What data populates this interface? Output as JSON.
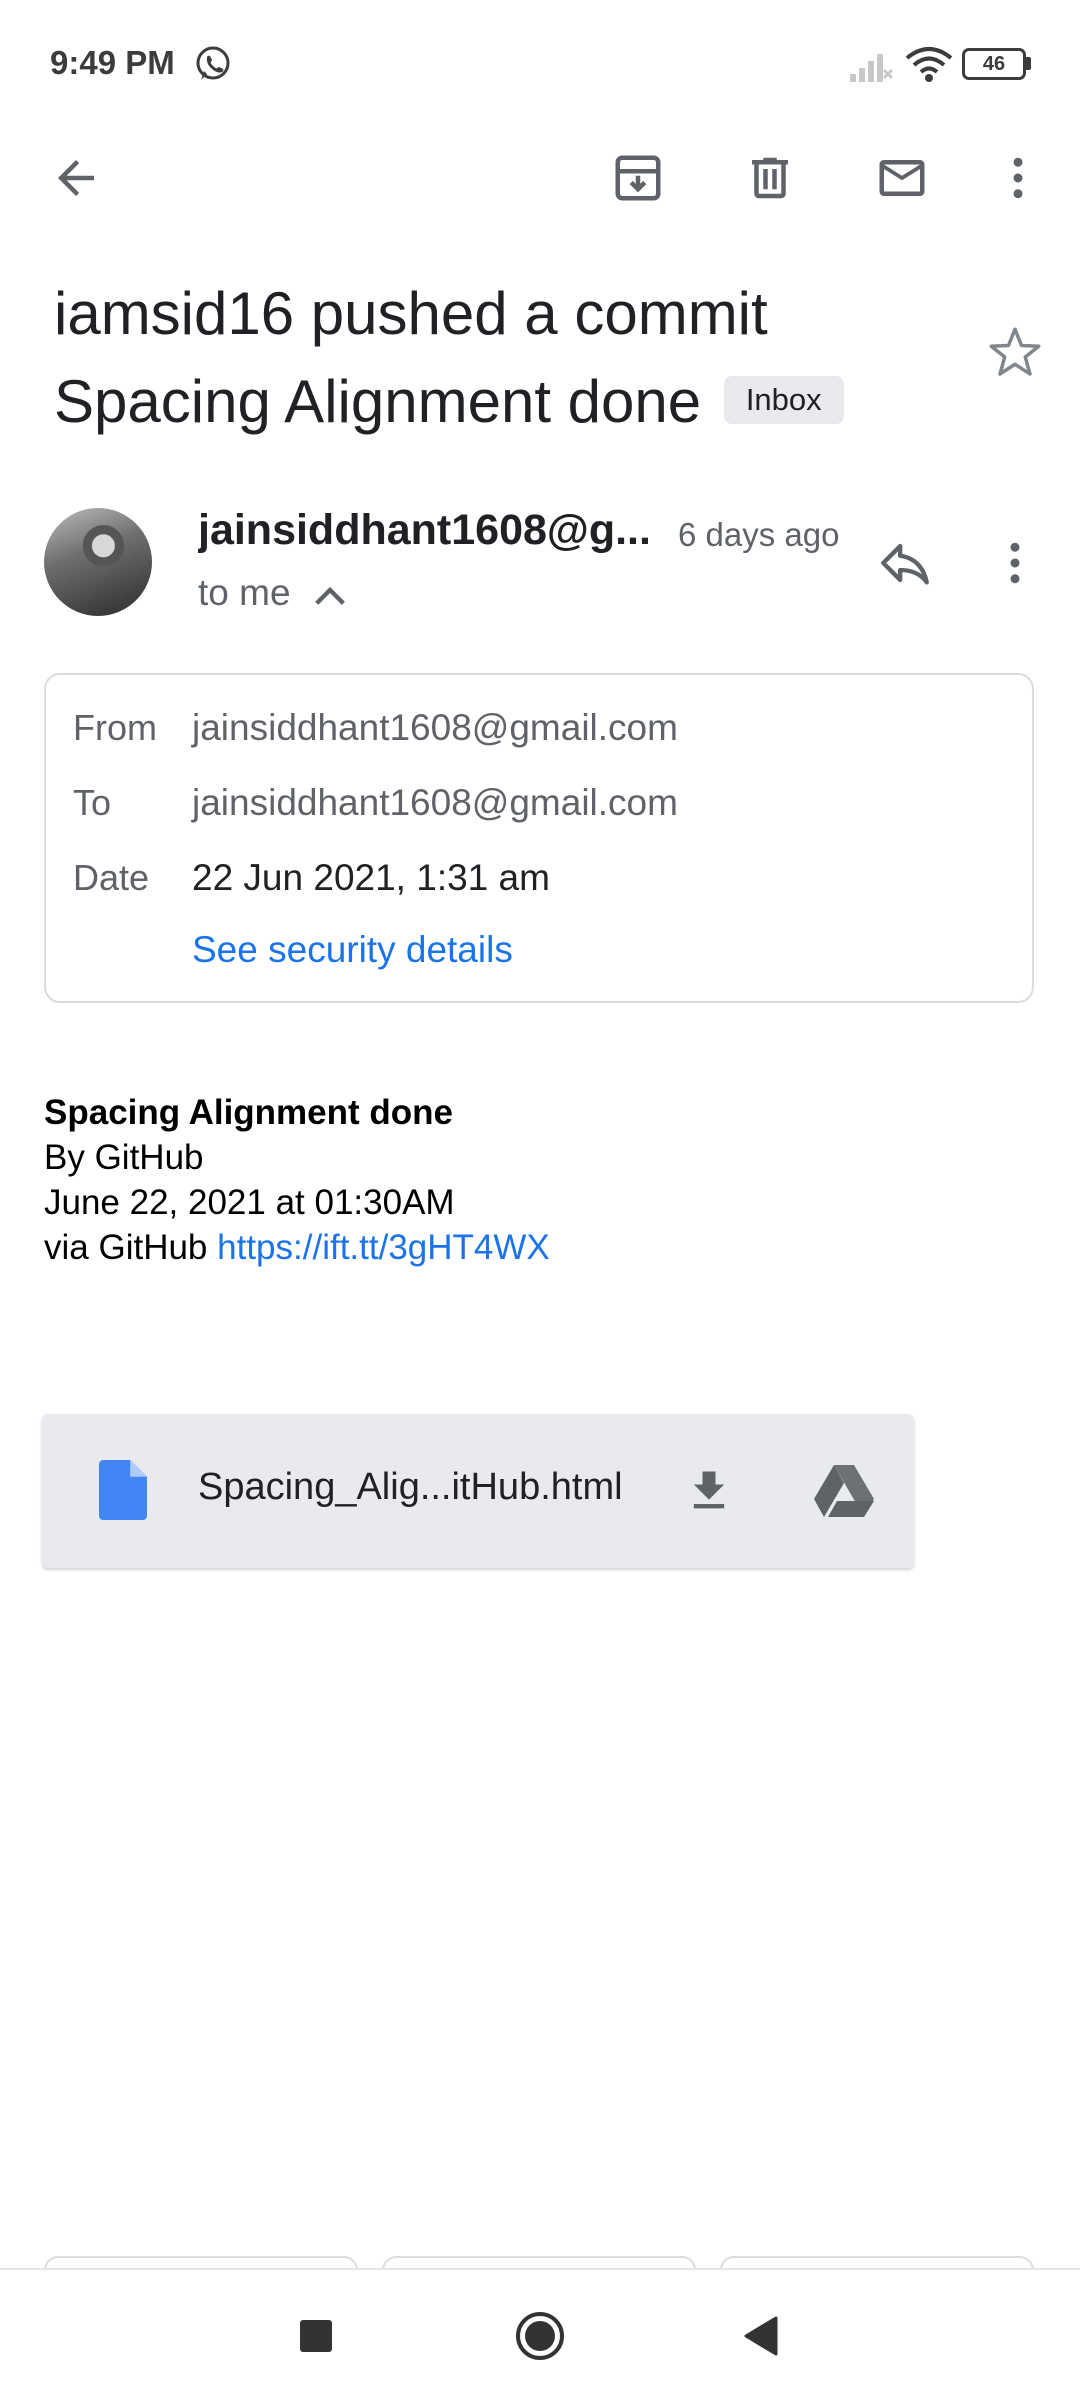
{
  "status_bar": {
    "time": "9:49 PM",
    "battery_level": "46",
    "icons": [
      "whatsapp-icon",
      "signal-icon",
      "wifi-icon",
      "battery-icon"
    ]
  },
  "toolbar": {
    "icons": [
      "back-arrow-icon",
      "archive-icon",
      "delete-icon",
      "mark-unread-icon",
      "more-vert-icon"
    ]
  },
  "email": {
    "subject_line1": "iamsid16 pushed a commit",
    "subject_line2": "Spacing Alignment done",
    "label": "Inbox",
    "starred": false,
    "sender_display": "jainsiddhant1608@g...",
    "time_ago": "6 days ago",
    "recipient_summary": "to me",
    "details": {
      "from_label": "From",
      "from_value": "jainsiddhant1608@gmail.com",
      "to_label": "To",
      "to_value": "jainsiddhant1608@gmail.com",
      "date_label": "Date",
      "date_value": "22 Jun 2021, 1:31 am",
      "security_link": "See security details"
    },
    "body": {
      "title": "Spacing Alignment done",
      "by_line": "By GitHub",
      "date_line": "June 22, 2021 at 01:30AM",
      "via_prefix": "via GitHub",
      "link_text": "https://ift.tt/3gHT4WX"
    },
    "attachment": {
      "file_name": "Spacing_Alig...itHub.html",
      "icons": [
        "document-icon",
        "download-icon",
        "drive-icon"
      ]
    }
  },
  "colors": {
    "accent_link": "#1a73e8",
    "chip_background": "#e8eaed",
    "doc_icon": "#4285f4",
    "icon_gray": "#5f6368"
  },
  "nav_bar": {
    "icons": [
      "recents-square-icon",
      "home-circle-icon",
      "back-triangle-icon"
    ]
  }
}
